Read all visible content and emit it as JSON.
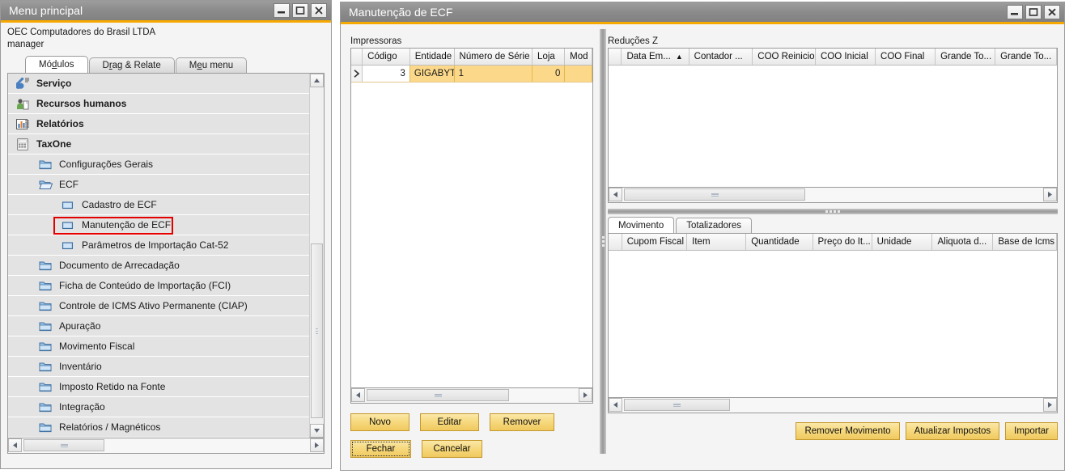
{
  "menu_window": {
    "title": "Menu principal",
    "company": "OEC Computadores do Brasil LTDA",
    "user": "manager",
    "window_buttons": {
      "minimize": "minimize-icon",
      "maximize": "maximize-icon",
      "close": "close-icon"
    },
    "tabs": [
      {
        "label": "Módulos",
        "accel": "d",
        "active": true
      },
      {
        "label": "Drag & Relate",
        "accel": "r",
        "active": false
      },
      {
        "label": "Meu menu",
        "accel": "e",
        "active": false
      }
    ],
    "tree": [
      {
        "label": "Serviço",
        "level": 0,
        "icon": "wrench-icon",
        "bold": true
      },
      {
        "label": "Recursos humanos",
        "level": 0,
        "icon": "human-resources-icon",
        "bold": true
      },
      {
        "label": "Relatórios",
        "level": 0,
        "icon": "bar-chart-icon",
        "bold": true
      },
      {
        "label": "TaxOne",
        "level": 0,
        "icon": "calculator-icon",
        "bold": true
      },
      {
        "label": "Configurações Gerais",
        "level": 1,
        "icon": "folder-icon",
        "bold": false
      },
      {
        "label": "ECF",
        "level": 1,
        "icon": "folder-open-icon",
        "bold": false
      },
      {
        "label": "Cadastro de ECF",
        "level": 2,
        "icon": "page-icon",
        "bold": false
      },
      {
        "label": "Manutenção de ECF",
        "level": 2,
        "icon": "page-icon",
        "bold": false,
        "highlighted": true
      },
      {
        "label": "Parâmetros de Importação Cat-52",
        "level": 2,
        "icon": "page-icon",
        "bold": false
      },
      {
        "label": "Documento de Arrecadação",
        "level": 1,
        "icon": "folder-icon",
        "bold": false
      },
      {
        "label": "Ficha de Conteúdo de Importação (FCI)",
        "level": 1,
        "icon": "folder-icon",
        "bold": false
      },
      {
        "label": "Controle de ICMS Ativo Permanente (CIAP)",
        "level": 1,
        "icon": "folder-icon",
        "bold": false
      },
      {
        "label": "Apuração",
        "level": 1,
        "icon": "folder-icon",
        "bold": false
      },
      {
        "label": "Movimento Fiscal",
        "level": 1,
        "icon": "folder-icon",
        "bold": false
      },
      {
        "label": "Inventário",
        "level": 1,
        "icon": "folder-icon",
        "bold": false
      },
      {
        "label": "Imposto Retido na Fonte",
        "level": 1,
        "icon": "folder-icon",
        "bold": false
      },
      {
        "label": "Integração",
        "level": 1,
        "icon": "folder-icon",
        "bold": false
      },
      {
        "label": "Relatórios / Magnéticos",
        "level": 1,
        "icon": "folder-icon",
        "bold": false
      }
    ]
  },
  "ecf_window": {
    "title": "Manutenção de ECF",
    "window_buttons": {
      "minimize": "minimize-icon",
      "maximize": "maximize-icon",
      "close": "close-icon"
    },
    "printers_panel": {
      "label": "Impressoras",
      "columns": [
        "Código",
        "Entidade",
        "Número de Série",
        "Loja",
        "Mod"
      ],
      "rows": [
        {
          "indicator": "▶",
          "Código": "3",
          "Entidade": "GIGABYTE",
          "Número de Série": "1",
          "Loja": "0",
          "Mod": ""
        }
      ]
    },
    "reducoes_panel": {
      "label": "Reduções Z",
      "columns": [
        "Data Em...",
        "Contador ...",
        "COO Reinicio",
        "COO Inicial",
        "COO Final",
        "Grande To...",
        "Grande To..."
      ],
      "sort_indicator": "▲",
      "sort_column_index": 0,
      "rows": []
    },
    "movimento_panel": {
      "tabs": [
        {
          "label": "Movimento",
          "active": true
        },
        {
          "label": "Totalizadores",
          "active": false
        }
      ],
      "columns": [
        "Cupom Fiscal",
        "Item",
        "Quantidade",
        "Preço do It...",
        "Unidade",
        "Aliquota d...",
        "Base de Icms"
      ],
      "rows": []
    },
    "left_buttons_row1": [
      {
        "label": "Novo",
        "focused": false
      },
      {
        "label": "Editar",
        "focused": false
      },
      {
        "label": "Remover",
        "focused": false
      }
    ],
    "left_buttons_row2": [
      {
        "label": "Fechar",
        "focused": true
      },
      {
        "label": "Cancelar",
        "focused": false
      }
    ],
    "right_buttons": [
      {
        "label": "Remover Movimento"
      },
      {
        "label": "Atualizar Impostos"
      },
      {
        "label": "Importar"
      }
    ]
  },
  "colors": {
    "accent": "#f5a800",
    "titlebar": "#8b8b8b",
    "selected_row": "#fcd98a",
    "button": "#f6d87c",
    "highlight_box": "#e50000"
  }
}
